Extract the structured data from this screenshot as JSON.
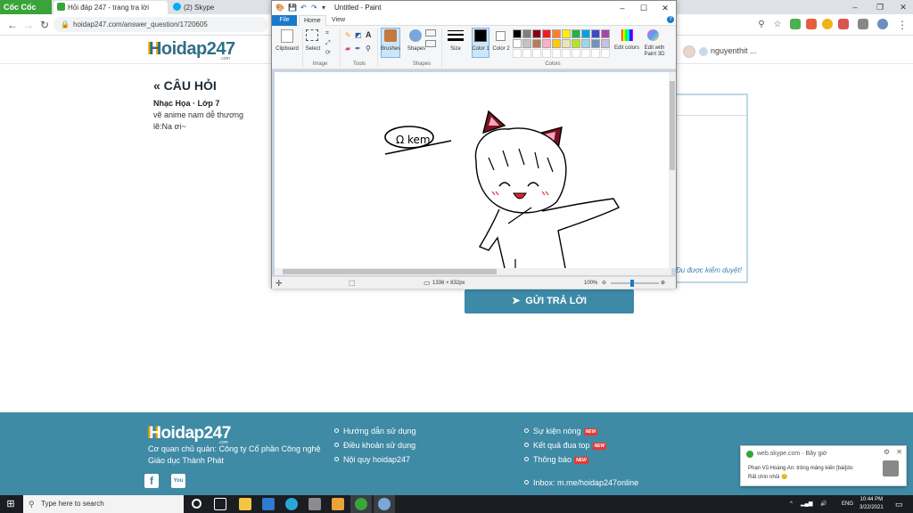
{
  "browser": {
    "logo_text": "Cốc Cốc",
    "tabs": [
      {
        "label": "Hỏi đáp 247 - trang tra lời"
      },
      {
        "label": "(2) Skype"
      }
    ],
    "address": "hoidap247.com/answer_question/1720605"
  },
  "site": {
    "logo": "Hoidap247",
    "logo_sub": ".com",
    "username": "nguyenthit ..."
  },
  "question": {
    "heading": "« CÂU HỎI",
    "meta": "Nhạc Họa · Lớp 7",
    "line1": "vẽ anime nam dễ thương",
    "line2": "lẽ:Na ơi~"
  },
  "answer": {
    "moderation_note": "Đu được kiểm duyệt!",
    "submit_label": "GỬI TRẢ LỜI"
  },
  "paint": {
    "title": "Untitled - Paint",
    "tab_file": "File",
    "tab_home": "Home",
    "tab_view": "View",
    "help": "?",
    "groups": {
      "clipboard": "Clipboard",
      "select": "Select",
      "image": "Image",
      "tools": "Tools",
      "brushes": "Brushes",
      "shapes": "Shapes",
      "size": "Size",
      "color1": "Color 1",
      "color2": "Color 2",
      "colors": "Colors",
      "edit_colors": "Edit colors",
      "edit_3d": "Edit with Paint 3D"
    },
    "palette": [
      "#000000",
      "#7f7f7f",
      "#880015",
      "#ed1c24",
      "#ff7f27",
      "#fff200",
      "#22b14c",
      "#00a2e8",
      "#3f48cc",
      "#a349a4",
      "#ffffff",
      "#c3c3c3",
      "#b97a57",
      "#ffaec9",
      "#ffc90e",
      "#efe4b0",
      "#b5e61d",
      "#99d9ea",
      "#7092be",
      "#c8bfe7"
    ],
    "drawing_text": "Ω kem",
    "status_size": "1336 × 832px",
    "zoom": "100%"
  },
  "footer": {
    "logo": "Hoidap247",
    "logo_sub": ".com",
    "company_line1": "Cơ quan chủ quản: Công ty Cổ phần Công nghệ",
    "company_line2": "Giáo dục Thành Phát",
    "facebook": "f",
    "youtube": "You",
    "links_col1": [
      "Hướng dẫn sử dụng",
      "Điều khoản sử dụng",
      "Nội quy hoidap247"
    ],
    "links_col2": [
      "Sự kiện nóng",
      "Kết quả đua top",
      "Thông báo"
    ],
    "new_badge": "NEW",
    "inbox": "Inbox: m.me/hoidap247online"
  },
  "notification": {
    "source": "web.skype.com · Bây giờ",
    "message": "Phan Vũ Hoàng An: trông mảng kiến [bài]do:",
    "message2": "Rất chìn nhỏi 😊"
  },
  "taskbar": {
    "search_placeholder": "Type here to search",
    "lang": "ENG",
    "time": "10:44 PM",
    "date": "3/22/2021"
  }
}
